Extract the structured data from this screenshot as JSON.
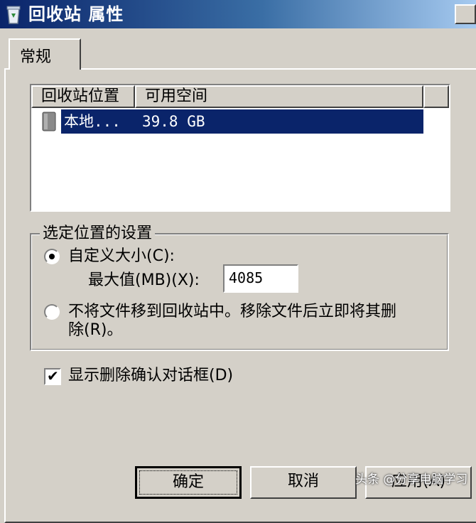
{
  "window": {
    "title": "回收站 属性",
    "icon": "recycle-bin-icon",
    "title_gradient": [
      "#0a246a",
      "#a6caf0"
    ]
  },
  "tabs": [
    {
      "label": "常规",
      "selected": true
    }
  ],
  "list": {
    "columns": [
      "回收站位置",
      "可用空间"
    ],
    "rows": [
      {
        "location": "本地...",
        "free_space": "39.8 GB",
        "selected": true,
        "icon": "drive-icon"
      }
    ],
    "selection_color": "#0a246a"
  },
  "settings_group": {
    "title": "选定位置的设置",
    "custom_size": {
      "label": "自定义大小(C):",
      "checked": true
    },
    "max_size": {
      "label": "最大值(MB)(X):",
      "value": "4085"
    },
    "delete_immediately": {
      "label_line1": "不将文件移到回收站中。移除文件后立即将其删",
      "label_line2": "除(R)。",
      "checked": false
    }
  },
  "confirm_dialog": {
    "label": "显示删除确认对话框(D)",
    "checked": true
  },
  "buttons": {
    "ok": "确定",
    "cancel": "取消",
    "apply": "应用(A)"
  },
  "watermark": "头条 @分享电脑学习"
}
